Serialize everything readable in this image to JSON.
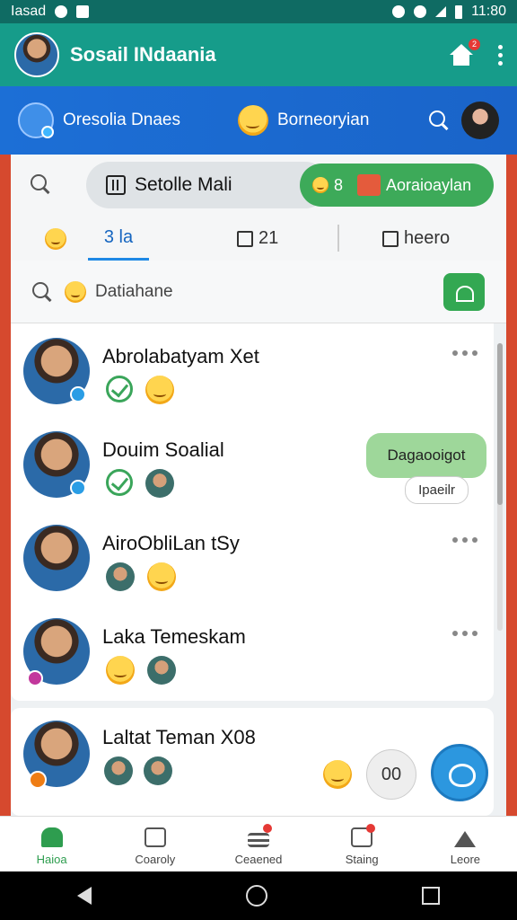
{
  "statusbar": {
    "carrier": "Iasad",
    "time": "11:80"
  },
  "appbar": {
    "title": "Sosail INdaania",
    "notification_count": "2"
  },
  "stories": {
    "item1_label": "Oresolia Dnaes",
    "item2_label": "Borneoryian"
  },
  "tabs": {
    "pill_label": "Setolle Mali",
    "green_count": "8",
    "green_label": "Aoraioaylan",
    "tab1": "3 la",
    "tab2": "21",
    "tab3": "heero"
  },
  "search": {
    "placeholder": "Datiahane"
  },
  "contacts": [
    {
      "name": "Abrolabatyam Xet"
    },
    {
      "name": "Douim Soalial",
      "bubble": "Dagaooigot",
      "bubble_sub": "Ipaeilr"
    },
    {
      "name": "AiroObliLan tSy"
    },
    {
      "name": "Laka Temeskam"
    }
  ],
  "card2": {
    "name": "Laltat Teman X08",
    "button_label": "00"
  },
  "bottomnav": [
    {
      "label": "Haioa"
    },
    {
      "label": "Coaroly"
    },
    {
      "label": "Ceaened"
    },
    {
      "label": "Staing"
    },
    {
      "label": "Leore"
    }
  ],
  "colors": {
    "appbar": "#169c8a",
    "storybar": "#1c6fd6",
    "accent_green": "#3daa59",
    "fab": "#2c97df"
  },
  "icons": [
    "home-icon",
    "kebab-menu-icon",
    "search-icon",
    "grid-icon",
    "gift-icon",
    "book-icon",
    "heart-icon",
    "check-icon",
    "chat-icon"
  ]
}
